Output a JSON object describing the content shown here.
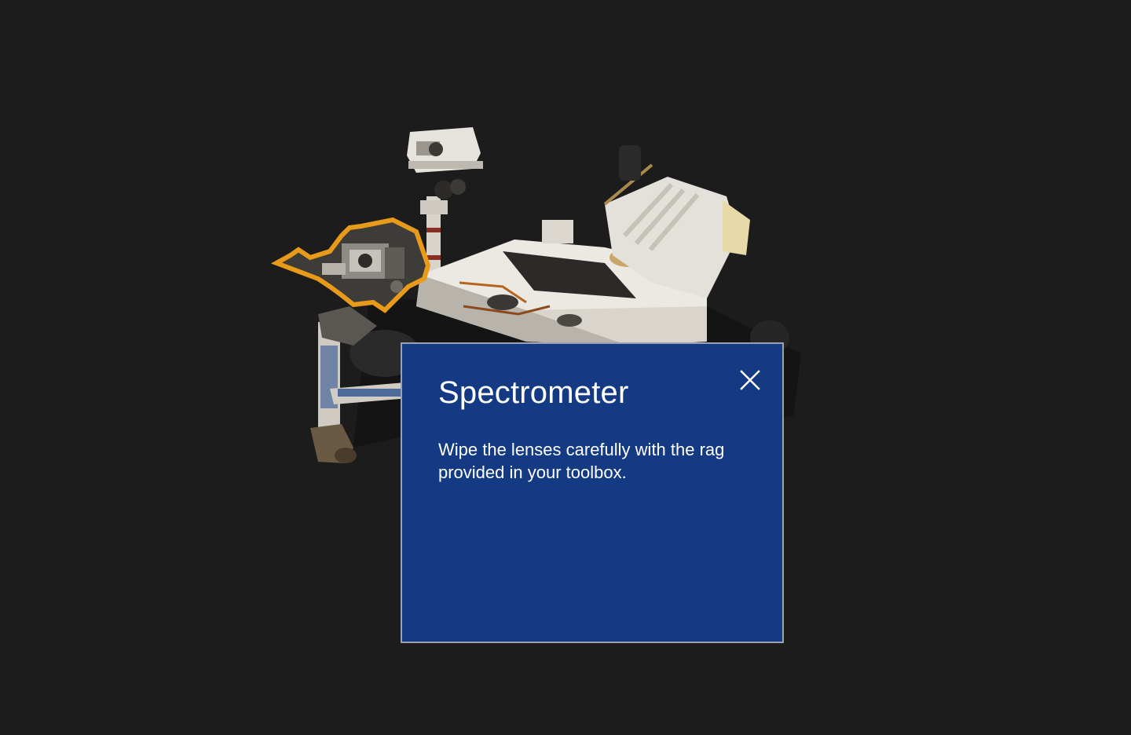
{
  "highlight_color": "#e89a1a",
  "panel": {
    "title": "Spectrometer",
    "body": "Wipe the lenses carefully with the rag provided in your toolbox.",
    "background": "#133a82",
    "close_icon": "close-icon"
  }
}
